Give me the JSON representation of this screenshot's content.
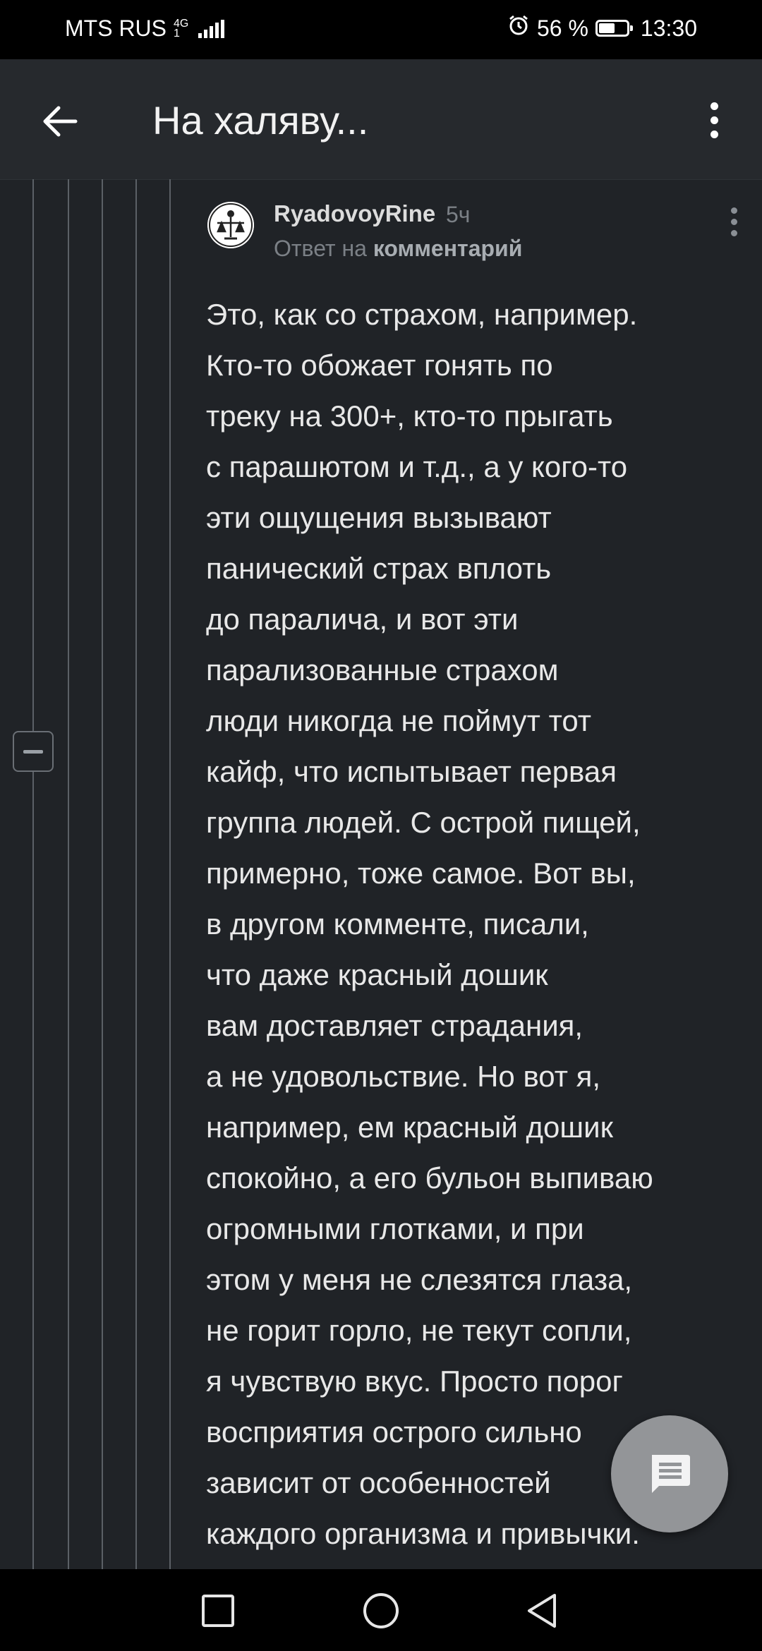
{
  "status_bar": {
    "carrier": "MTS RUS",
    "network_top": "4G",
    "network_bottom": "1",
    "battery_percent": "56 %",
    "battery_level": 0.56,
    "time": "13:30",
    "icons": [
      "signal-icon",
      "alarm-icon",
      "battery-icon"
    ]
  },
  "app_bar": {
    "title": "На халяву...",
    "back_icon": "arrow-left-icon",
    "more_icon": "more-vertical-icon"
  },
  "comment": {
    "username": "RyadovoyRine",
    "time_ago": "5ч",
    "reply_prefix": "Ответ на",
    "reply_target": "комментарий",
    "lines": [
      "Это, как со страхом, например.",
      "Кто-то обожает гонять по",
      "треку на 300+, кто-то прыгать",
      "с парашютом и т.д., а у кого-то",
      "эти ощущения вызывают",
      "панический страх вплоть",
      "до паралича, и вот эти",
      "парализованные страхом",
      "люди никогда не поймут тот",
      "кайф, что испытывает первая",
      "группа людей. С острой пищей,",
      "примерно, тоже самое. Вот вы,",
      "в другом комменте, писали,",
      "что даже красный дошик",
      "вам доставляет страдания,",
      "а не удовольствие. Но вот я,",
      "например, ем красный дошик",
      "спокойно, а его бульон выпиваю",
      "огромными глотками, и при",
      "этом у меня не слезятся глаза,",
      "не горит горло, не текут сопли,",
      "я чувствую вкус. Просто порог",
      "восприятия острого сильно",
      "зависит от особенностей",
      "каждого организма и привычки."
    ]
  },
  "colors": {
    "background": "#202327",
    "app_bar": "#26292d",
    "thread_line": "#5b6066",
    "fab": "#9a9c9f"
  },
  "nav_bar": {
    "icons": [
      "square-recents-icon",
      "circle-home-icon",
      "triangle-back-icon"
    ]
  }
}
